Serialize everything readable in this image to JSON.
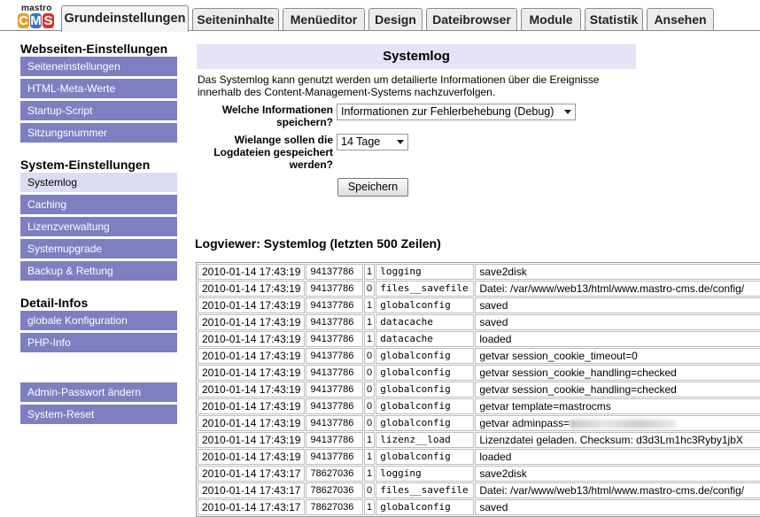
{
  "logo": {
    "top": "mastro",
    "cms": [
      "C",
      "M",
      "S"
    ]
  },
  "tabs": [
    {
      "label": "Grundeinstellungen",
      "active": true
    },
    {
      "label": "Seiteninhalte"
    },
    {
      "label": "Menüeditor"
    },
    {
      "label": "Design"
    },
    {
      "label": "Dateibrowser"
    },
    {
      "label": "Module"
    },
    {
      "label": "Statistik"
    },
    {
      "label": "Ansehen"
    }
  ],
  "sidebar": {
    "sections": [
      {
        "title": "Webseiten-Einstellungen",
        "items": [
          "Seiteneinstellungen",
          "HTML-Meta-Werte",
          "Startup-Script",
          "Sitzungsnummer"
        ]
      },
      {
        "title": "System-Einstellungen",
        "items": [
          "Systemlog",
          "Caching",
          "Lizenzverwaltung",
          "Systemupgrade",
          "Backup & Rettung"
        ]
      },
      {
        "title": "Detail-Infos",
        "items": [
          "globale Konfiguration",
          "PHP-Info"
        ]
      },
      {
        "title": "",
        "items": [
          "Admin-Passwort ändern",
          "System-Reset"
        ]
      }
    ],
    "active_item": "Systemlog"
  },
  "main": {
    "title": "Systemlog",
    "intro": "Das Systemlog kann genutzt werden um detailierte Informationen über die Ereignisse innerhalb des Content-Management-Systems nachzuverfolgen.",
    "info_label": "Welche Informationen speichern?",
    "info_value": "Informationen zur Fehlerbehebung (Debug)",
    "keep_label": "Wielange sollen die Logdateien gespeichert werden?",
    "keep_value": "14 Tage",
    "save_label": "Speichern",
    "log_title": "Logviewer: Systemlog (letzten 500 Zeilen)"
  },
  "log_rows": [
    [
      "2010-01-14 17:43:19",
      "94137786",
      "1",
      "logging",
      "save2disk"
    ],
    [
      "2010-01-14 17:43:19",
      "94137786",
      "0",
      "files__savefile",
      "Datei: /var/www/web13/html/www.mastro-cms.de/config/"
    ],
    [
      "2010-01-14 17:43:19",
      "94137786",
      "1",
      "globalconfig",
      "saved"
    ],
    [
      "2010-01-14 17:43:19",
      "94137786",
      "1",
      "datacache",
      "saved"
    ],
    [
      "2010-01-14 17:43:19",
      "94137786",
      "1",
      "datacache",
      "loaded"
    ],
    [
      "2010-01-14 17:43:19",
      "94137786",
      "0",
      "globalconfig",
      "getvar session_cookie_timeout=0"
    ],
    [
      "2010-01-14 17:43:19",
      "94137786",
      "0",
      "globalconfig",
      "getvar session_cookie_handling=checked"
    ],
    [
      "2010-01-14 17:43:19",
      "94137786",
      "0",
      "globalconfig",
      "getvar session_cookie_handling=checked"
    ],
    [
      "2010-01-14 17:43:19",
      "94137786",
      "0",
      "globalconfig",
      "getvar template=mastrocms"
    ],
    [
      "2010-01-14 17:43:19",
      "94137786",
      "0",
      "globalconfig",
      "getvar adminpass="
    ],
    [
      "2010-01-14 17:43:19",
      "94137786",
      "1",
      "lizenz__load",
      "Lizenzdatei geladen. Checksum: d3d3Lm1hc3Ryby1jbX"
    ],
    [
      "2010-01-14 17:43:19",
      "94137786",
      "1",
      "globalconfig",
      "loaded"
    ],
    [
      "2010-01-14 17:43:17",
      "78627036",
      "1",
      "logging",
      "save2disk"
    ],
    [
      "2010-01-14 17:43:17",
      "78627036",
      "0",
      "files__savefile",
      "Datei: /var/www/web13/html/www.mastro-cms.de/config/"
    ],
    [
      "2010-01-14 17:43:17",
      "78627036",
      "1",
      "globalconfig",
      "saved"
    ]
  ],
  "colors": {
    "sidebar_item": "#7d7fc0",
    "sidebar_active": "#dcdcf2",
    "panel_title_bg": "#e4e4f6"
  }
}
